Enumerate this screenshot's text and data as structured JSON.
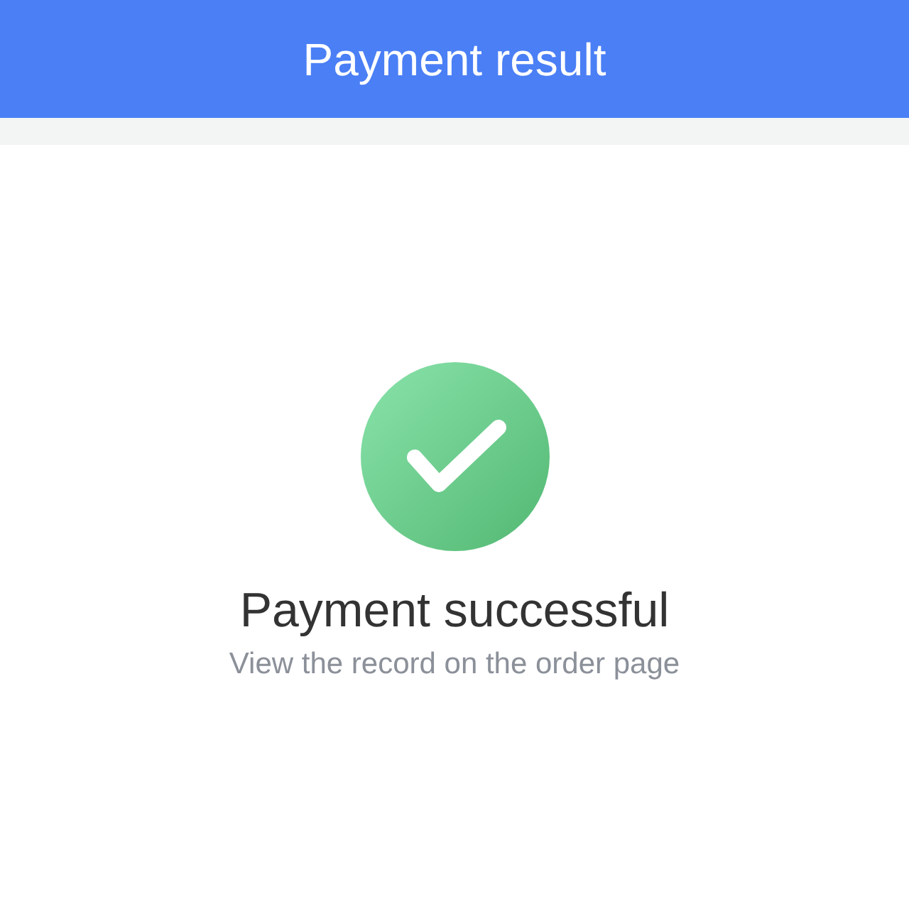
{
  "header": {
    "title": "Payment result"
  },
  "result": {
    "kind": "success",
    "title": "Payment successful",
    "message": "View the record on the order page"
  }
}
